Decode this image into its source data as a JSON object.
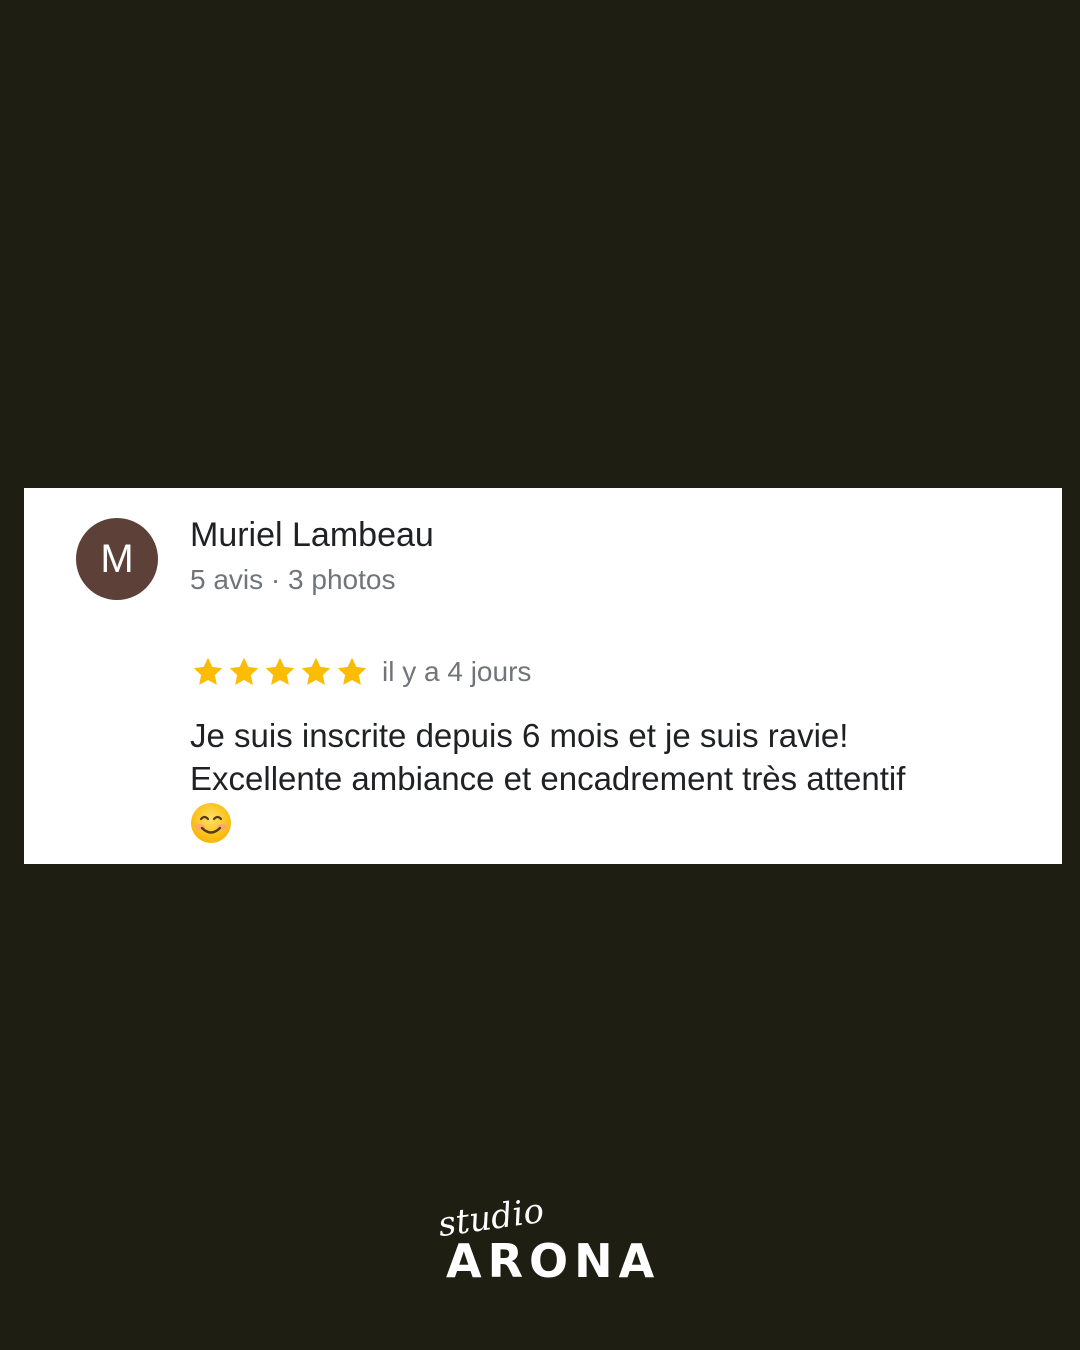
{
  "review": {
    "reviewer_initial": "M",
    "reviewer_name": "Muriel Lambeau",
    "reviewer_meta": "5 avis · 3 photos",
    "rating": 5,
    "rating_max": 5,
    "time_ago": "il y a 4 jours",
    "text_line1": "Je suis inscrite depuis 6 mois et je suis ravie!",
    "text_line2": "Excellente ambiance et encadrement très attentif",
    "emoji_icon": "smiling-face-icon",
    "avatar_color": "#5d4037",
    "star_color": "#fbbc04"
  },
  "brand": {
    "script": "studio",
    "name": "ARONA"
  },
  "colors": {
    "background": "#1e1e13",
    "card": "#ffffff"
  }
}
